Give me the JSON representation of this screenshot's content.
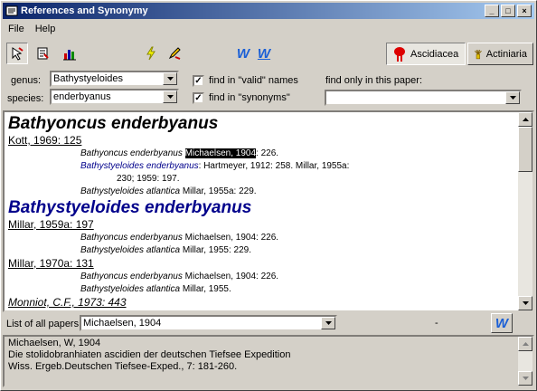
{
  "window": {
    "title": "References and Synonymy"
  },
  "menu": [
    "File",
    "Help"
  ],
  "toolbar": {
    "tab_ascidiacea": "Ascidiacea",
    "tab_actiniaria": "Actiniaria",
    "w1": "W",
    "w2": "W"
  },
  "filters": {
    "genus_label": "genus:",
    "genus_value": "Bathystyeloides",
    "species_label": "species:",
    "species_value": "enderbyanus",
    "find_valid_label": "find in \"valid\" names",
    "find_valid_checked": true,
    "find_syn_label": "find in \"synonyms\"",
    "find_syn_checked": true,
    "paper_label": "find only in this paper:",
    "paper_value": ""
  },
  "results": {
    "entry1": {
      "name": "Bathyoncus enderbyanus",
      "ref1": {
        "paper": "Kott, 1969: 125",
        "line1_name": "Bathyoncus enderbyanus",
        "line1_author": "Michaelsen, 1904",
        "line1_rest": ": 226.",
        "line2_name": "Bathystyeloides enderbyanus",
        "line2_rest": ": Hartmeyer, 1912: 258. Millar, 1955a:",
        "line2_cont": "230; 1959: 197.",
        "line3_name": "Bathystyeloides atlantica",
        "line3_rest": " Millar, 1955a: 229."
      }
    },
    "entry2": {
      "name": "Bathystyeloides enderbyanus",
      "ref1": {
        "paper": "Millar, 1959a: 197",
        "line1_name": "Bathyoncus enderbyanus",
        "line1_rest": " Michaelsen, 1904: 226.",
        "line2_name": "Bathystyeloides atlantica",
        "line2_rest": " Millar, 1955: 229."
      },
      "ref2": {
        "paper": "Millar, 1970a: 131",
        "line1_name": "Bathyoncus enderbyanus",
        "line1_rest": " Michaelsen, 1904: 226.",
        "line2_name": "Bathystyeloides atlantica",
        "line2_rest": " Millar, 1955."
      },
      "ref3": {
        "paper": "Monniot, C.F., 1973: 443"
      }
    }
  },
  "papers": {
    "label": "List of all papers:",
    "value": "Michaelsen, 1904",
    "dash": "-",
    "w": "W"
  },
  "details": {
    "line1": "Michaelsen, W, 1904",
    "line2": "Die stolidobranhiaten ascidien der deutschen Tiefsee Expedition",
    "line3": "Wiss. Ergeb.Deutschen Tiefsee-Exped., 7: 181-260."
  }
}
